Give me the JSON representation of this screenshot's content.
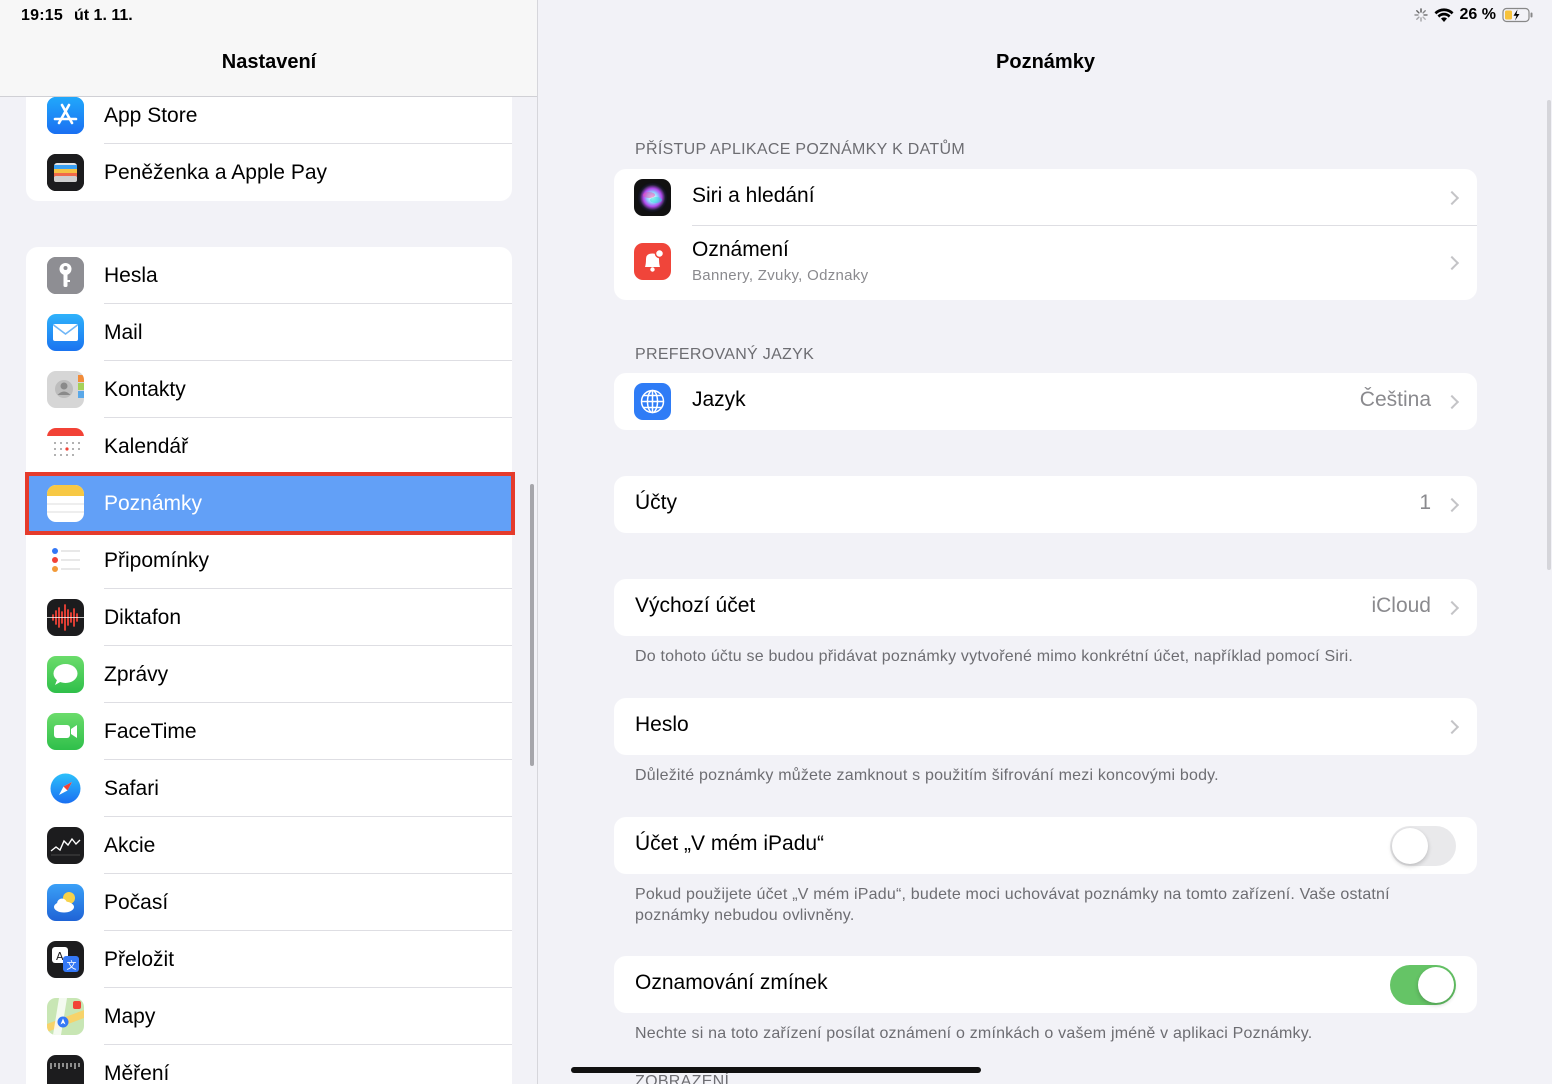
{
  "status": {
    "time": "19:15",
    "date": "út 1. 11.",
    "battery": "26 %"
  },
  "left": {
    "title": "Nastavení",
    "group1": [
      {
        "label": "App Store",
        "icon": "app-store-icon"
      },
      {
        "label": "Peněženka a Apple Pay",
        "icon": "wallet-icon"
      }
    ],
    "group2": [
      {
        "label": "Hesla",
        "icon": "key-icon"
      },
      {
        "label": "Mail",
        "icon": "mail-icon"
      },
      {
        "label": "Kontakty",
        "icon": "contacts-icon"
      },
      {
        "label": "Kalendář",
        "icon": "calendar-icon"
      },
      {
        "label": "Poznámky",
        "icon": "notes-icon",
        "selected": true
      },
      {
        "label": "Připomínky",
        "icon": "reminders-icon"
      },
      {
        "label": "Diktafon",
        "icon": "voice-memos-icon"
      },
      {
        "label": "Zprávy",
        "icon": "messages-icon"
      },
      {
        "label": "FaceTime",
        "icon": "facetime-icon"
      },
      {
        "label": "Safari",
        "icon": "safari-icon"
      },
      {
        "label": "Akcie",
        "icon": "stocks-icon"
      },
      {
        "label": "Počasí",
        "icon": "weather-icon"
      },
      {
        "label": "Přeložit",
        "icon": "translate-icon"
      },
      {
        "label": "Mapy",
        "icon": "maps-icon"
      },
      {
        "label": "Měření",
        "icon": "measure-icon"
      }
    ]
  },
  "right": {
    "title": "Poznámky",
    "section_access": "PŘÍSTUP APLIKACE POZNÁMKY K DATŮM",
    "siri": "Siri a hledání",
    "notifications": "Oznámení",
    "notifications_sub": "Bannery, Zvuky, Odznaky",
    "section_language": "PREFEROVANÝ JAZYK",
    "language": "Jazyk",
    "language_value": "Čeština",
    "accounts": "Účty",
    "accounts_value": "1",
    "default_account": "Výchozí účet",
    "default_account_value": "iCloud",
    "default_account_footer": "Do tohoto účtu se budou přidávat poznámky vytvořené mimo konkrétní účet, například pomocí Siri.",
    "password": "Heslo",
    "password_footer": "Důležité poznámky můžete zamknout s použitím šifrování mezi koncovými body.",
    "on_ipad": "Účet „V mém iPadu“",
    "on_ipad_footer": "Pokud použijete účet „V mém iPadu“, budete moci uchovávat poznámky na tomto zařízení. Vaše ostatní poznámky nebudou ovlivněny.",
    "on_ipad_enabled": false,
    "mentions": "Oznamování zmínek",
    "mentions_footer": "Nechte si na toto zařízení posílat oznámení o zmínkách o vašem jméně v aplikaci Poznámky.",
    "mentions_enabled": true,
    "section_view": "ZOBRAZENÍ"
  },
  "colors": {
    "selected_row": "#62a0f7",
    "highlight_border": "#e53b2c",
    "toggle_on": "#65c466"
  }
}
